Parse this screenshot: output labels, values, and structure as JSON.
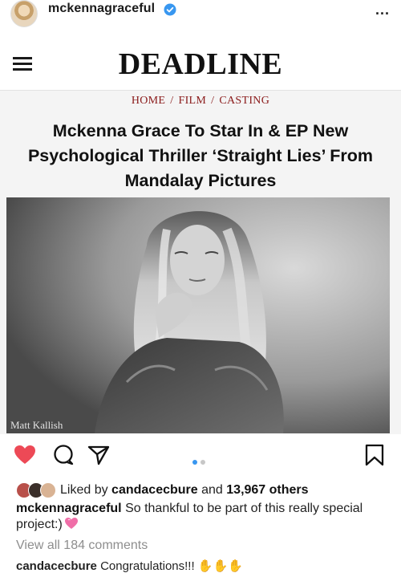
{
  "instagram": {
    "username": "mckennagraceful",
    "more_label": "..."
  },
  "article": {
    "site_name": "DEADLINE",
    "breadcrumb": [
      "HOME",
      "FILM",
      "CASTING"
    ],
    "breadcrumb_separator": "/",
    "headline": "Mckenna Grace To Star In & EP New Psychological Thriller ‘Straight Lies’ From Mandalay Pictures",
    "photo_credit": "Matt Kallish"
  },
  "carousel": {
    "slide_count": 2,
    "active_slide": 1,
    "active_color": "#3897f0",
    "inactive_color": "#c7c7c7"
  },
  "post": {
    "liked": true,
    "like_color": "#ed4956",
    "likes_prefix": "Liked by",
    "likes_user": "candacecbure",
    "likes_connector": "and",
    "likes_count": "13,967 others",
    "caption_user": "mckennagraceful",
    "caption_text": "So thankful to be part of this really special project:)",
    "view_comments": "View all 184 comments",
    "next_comment_user": "candacecbure",
    "next_comment_text": "Congratulations!!!"
  },
  "colors": {
    "verified_badge": "#3897f0",
    "breadcrumb": "#8a1a1a"
  }
}
